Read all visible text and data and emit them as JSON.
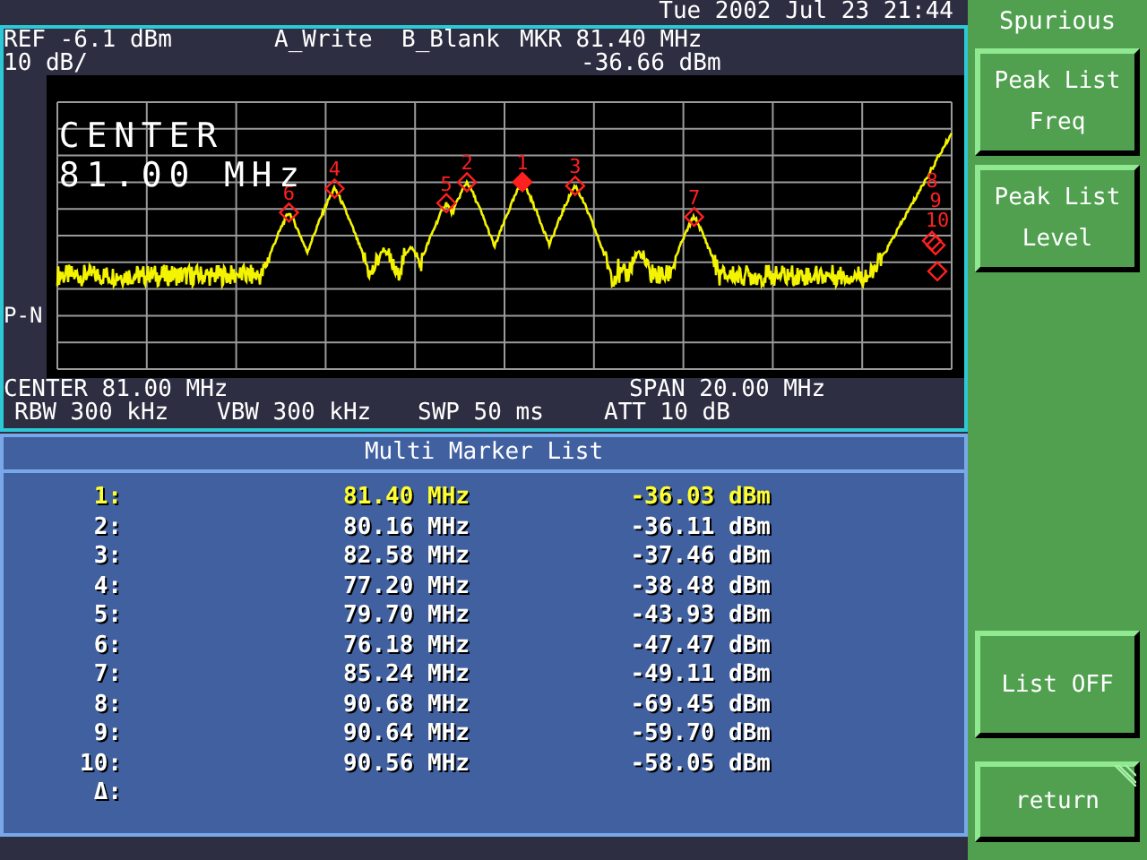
{
  "status_bar": {
    "datetime": "Tue 2002 Jul 23 21:44"
  },
  "header": {
    "ref": "REF -6.1 dBm",
    "trace_a": "A_Write",
    "trace_b": "B_Blank",
    "marker": "MKR 81.40 MHz",
    "scale": "10 dB/",
    "marker_level": "-36.66 dBm"
  },
  "plot": {
    "center_overlay": [
      "CENTER",
      "81.00 MHz"
    ],
    "detector": "P-N",
    "markers": [
      {
        "label": "6",
        "selected": false
      },
      {
        "label": "4",
        "selected": false
      },
      {
        "label": "5",
        "selected": false
      },
      {
        "label": "2",
        "selected": false
      },
      {
        "label": "1",
        "selected": true
      },
      {
        "label": "3",
        "selected": false
      },
      {
        "label": "7",
        "selected": false
      },
      {
        "label": "8",
        "selected": false
      },
      {
        "label": "9",
        "selected": false
      },
      {
        "label": "10",
        "selected": false
      }
    ]
  },
  "footer": {
    "center": "CENTER 81.00 MHz",
    "span": "SPAN 20.00 MHz",
    "rbw": "RBW 300 kHz",
    "vbw": "VBW 300 kHz",
    "swp": "SWP 50 ms",
    "att": "ATT 10 dB"
  },
  "marker_list": {
    "title": "Multi Marker List",
    "rows": [
      {
        "label": "1:",
        "freq": "81.40 MHz",
        "level": "-36.03 dBm",
        "selected": true
      },
      {
        "label": "2:",
        "freq": "80.16 MHz",
        "level": "-36.11 dBm",
        "selected": false
      },
      {
        "label": "3:",
        "freq": "82.58 MHz",
        "level": "-37.46 dBm",
        "selected": false
      },
      {
        "label": "4:",
        "freq": "77.20 MHz",
        "level": "-38.48 dBm",
        "selected": false
      },
      {
        "label": "5:",
        "freq": "79.70 MHz",
        "level": "-43.93 dBm",
        "selected": false
      },
      {
        "label": "6:",
        "freq": "76.18 MHz",
        "level": "-47.47 dBm",
        "selected": false
      },
      {
        "label": "7:",
        "freq": "85.24 MHz",
        "level": "-49.11 dBm",
        "selected": false
      },
      {
        "label": "8:",
        "freq": "90.68 MHz",
        "level": "-69.45 dBm",
        "selected": false
      },
      {
        "label": "9:",
        "freq": "90.64 MHz",
        "level": "-59.70 dBm",
        "selected": false
      },
      {
        "label": "10:",
        "freq": "90.56 MHz",
        "level": "-58.05 dBm",
        "selected": false
      },
      {
        "label": "Δ:",
        "selected": false
      }
    ]
  },
  "softkeys": {
    "title": "Spurious",
    "keys": [
      {
        "kind": "key",
        "label": "Peak List Freq"
      },
      {
        "kind": "key",
        "label": "Peak List Level"
      },
      {
        "kind": "blank"
      },
      {
        "kind": "blank"
      },
      {
        "kind": "blank"
      },
      {
        "kind": "key",
        "label": "List OFF"
      },
      {
        "kind": "return",
        "label": "return"
      }
    ]
  }
}
